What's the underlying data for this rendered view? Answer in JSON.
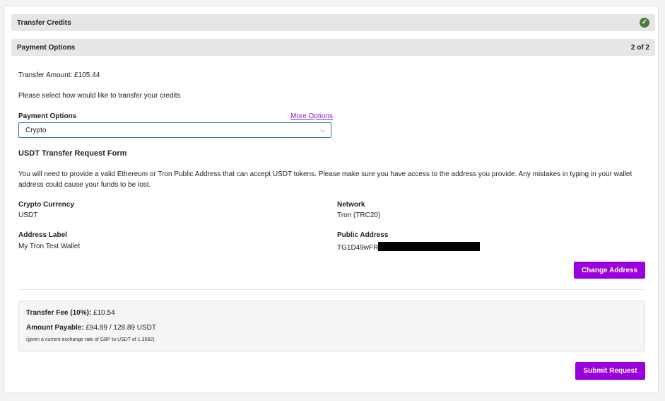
{
  "steps": [
    {
      "title": "Transfer Credits",
      "status": "complete"
    },
    {
      "title": "Payment Options",
      "progress": "2 of 2"
    }
  ],
  "transfer_amount": "Transfer Amount: £105.44",
  "instruction": "Please select how would like to transfer your credits",
  "payment_options": {
    "label": "Payment Options",
    "more_options": "More Options",
    "selected": "Crypto"
  },
  "usdt_form": {
    "title": "USDT Transfer Request Form",
    "description": "You will need to provide a valid Ethereum or Tron Public Address that can accept USDT tokens. Please make sure you have access to the address you provide. Any mistakes in typing in your wallet address could cause your funds to be lost.",
    "crypto_currency_label": "Crypto Currency",
    "crypto_currency_value": "USDT",
    "network_label": "Network",
    "network_value": "Tron (TRC20)",
    "address_label_label": "Address Label",
    "address_label_value": "My Tron Test Wallet",
    "public_address_label": "Public Address",
    "public_address_visible": "TG1D49wFR",
    "change_address_button": "Change Address"
  },
  "summary": {
    "fee_label": "Transfer Fee (10%):",
    "fee_value": "£10.54",
    "payable_label": "Amount Payable:",
    "payable_value": "£94.89 / 128.89 USDT",
    "note": "(given a current exchange rate of GBP to USDT of 1.3582)"
  },
  "submit_button": "Submit Request",
  "colors": {
    "accent": "#9900dd",
    "check": "#4a7c3b",
    "link": "#8a1fd6"
  }
}
